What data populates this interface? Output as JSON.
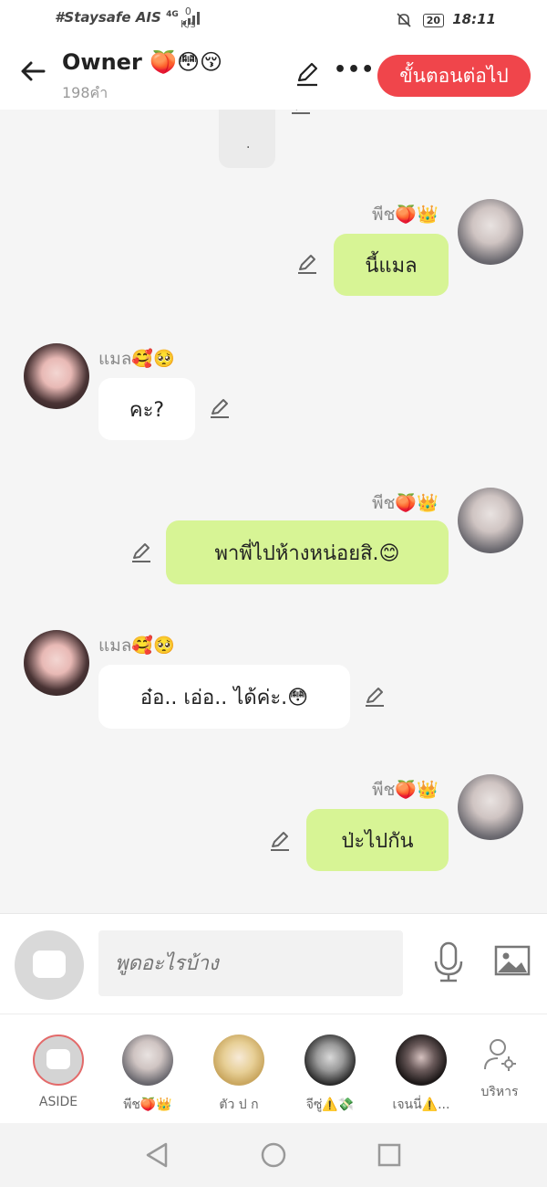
{
  "status_bar": {
    "carrier": "#Staysafe AIS",
    "net": "4G",
    "speed_value": "0",
    "speed_unit": "K/s",
    "battery": "20",
    "time": "18:11"
  },
  "header": {
    "title": "Owner 🍑😳😚",
    "subtitle": "198คำ",
    "next_button": "ขั้นตอนต่อไป"
  },
  "previous_bubble": {
    "text": "."
  },
  "messages": [
    {
      "side": "right",
      "name": "พีช🍑👑",
      "text": "นี้แมล"
    },
    {
      "side": "left",
      "name": "แมล🥰🥺",
      "text": "คะ?"
    },
    {
      "side": "right",
      "name": "พีช🍑👑",
      "text": "พาพี่ไปห้างหน่อยสิ.😊"
    },
    {
      "side": "left",
      "name": "แมล🥰🥺",
      "text": "อ๋อ.. เอ่อ.. ได้ค่ะ.😳"
    },
    {
      "side": "right",
      "name": "พีช🍑👑",
      "text": "ป่ะไปกัน"
    }
  ],
  "input": {
    "placeholder": "พูดอะไรบ้าง"
  },
  "dock": [
    {
      "label": "ASIDE"
    },
    {
      "label": "พีช🍑👑"
    },
    {
      "label": "ตัว ป ก"
    },
    {
      "label": "จีซู่⚠️💸"
    },
    {
      "label": "เจนนี่⚠️..."
    },
    {
      "label": "บริหาร"
    }
  ],
  "colors": {
    "accent": "#f0454b",
    "bubble_green": "#d7f495",
    "background": "#f5f5f5"
  },
  "icons": [
    "back-arrow-icon",
    "pencil-icon",
    "more-icon",
    "mic-icon",
    "image-icon",
    "manage-users-icon",
    "nav-back-icon",
    "nav-home-icon",
    "nav-recents-icon"
  ]
}
